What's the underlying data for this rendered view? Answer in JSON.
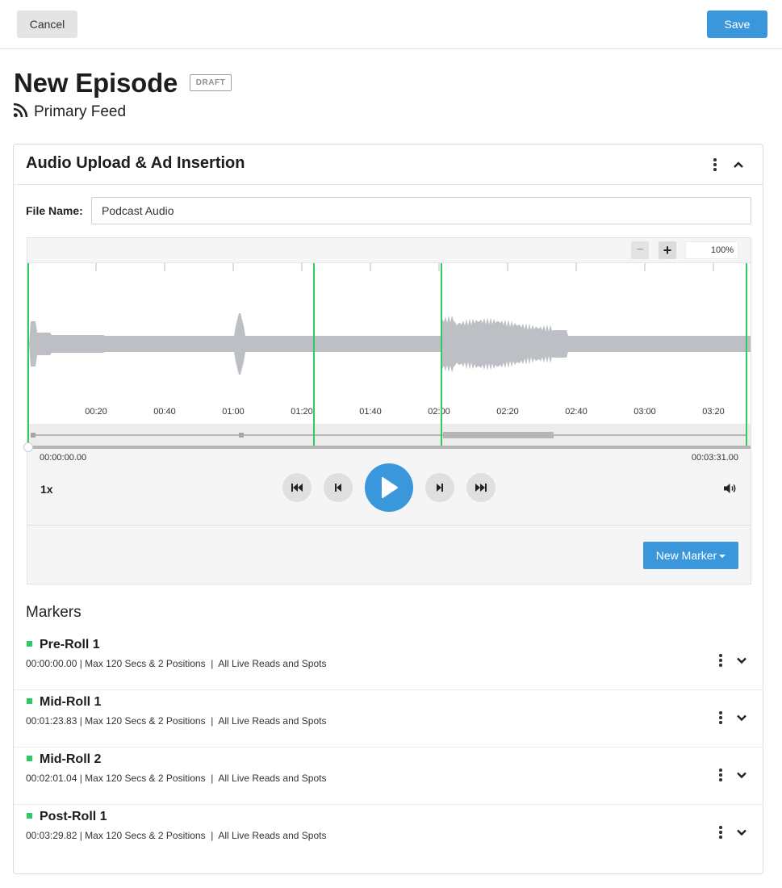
{
  "topbar": {
    "cancel_label": "Cancel",
    "save_label": "Save"
  },
  "episode": {
    "title": "New Episode",
    "status": "DRAFT",
    "feed": "Primary Feed"
  },
  "card": {
    "title": "Audio Upload & Ad Insertion"
  },
  "file": {
    "label": "File Name:",
    "value": "Podcast Audio"
  },
  "player": {
    "zoom_minus": "−",
    "zoom_plus": "+",
    "zoom_level": "100%",
    "time_ticks": [
      "00:20",
      "00:40",
      "01:00",
      "01:20",
      "01:40",
      "02:00",
      "02:20",
      "02:40",
      "03:00",
      "03:20"
    ],
    "current_time": "00:00:00.00",
    "duration": "00:03:31.00",
    "speed": "1x",
    "progress": 0,
    "new_marker_label": "New Marker",
    "accent_color": "#3a97dc",
    "marker_color": "#2ecc60"
  },
  "markers": {
    "heading": "Markers",
    "items": [
      {
        "name": "Pre-Roll 1",
        "meta": "00:00:00.00 | Max 120 Secs & 2 Positions  |  All Live Reads and Spots"
      },
      {
        "name": "Mid-Roll 1",
        "meta": "00:01:23.83 | Max 120 Secs & 2 Positions  |  All Live Reads and Spots"
      },
      {
        "name": "Mid-Roll 2",
        "meta": "00:02:01.04 | Max 120 Secs & 2 Positions  |  All Live Reads and Spots"
      },
      {
        "name": "Post-Roll 1",
        "meta": "00:03:29.82 | Max 120 Secs & 2 Positions  |  All Live Reads and Spots"
      }
    ]
  },
  "icons": {
    "feed": "rss-icon",
    "card_menu": "kebab-icon",
    "collapse": "chevron-up-icon",
    "skip_start": "skip-to-start-icon",
    "step_back": "step-back-icon",
    "play": "play-icon",
    "step_forward": "step-forward-icon",
    "skip_end": "skip-to-end-icon",
    "volume": "volume-icon",
    "expand": "chevron-down-icon"
  }
}
